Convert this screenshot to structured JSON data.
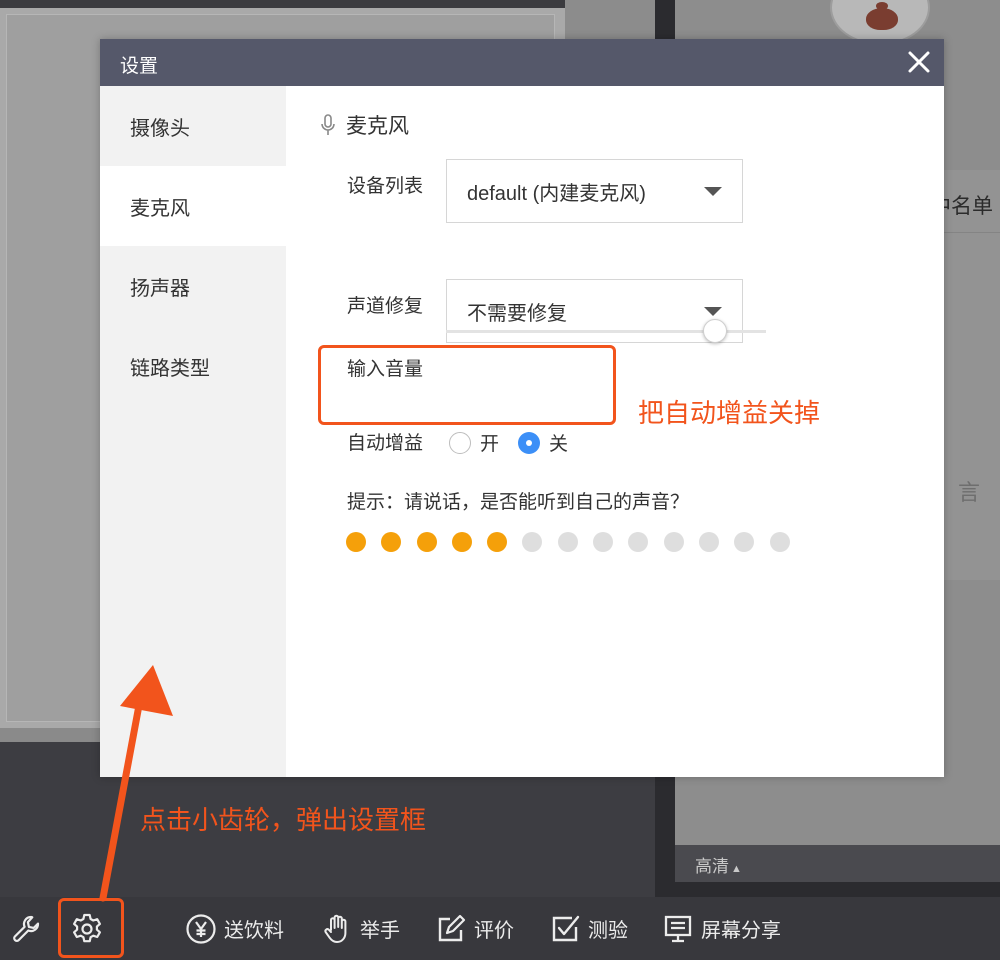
{
  "background": {
    "list_tab_label": "中名单",
    "speak_text": "言",
    "quality_label": "高清"
  },
  "toolbar": {
    "drink_label": "送饮料",
    "hand_label": "举手",
    "review_label": "评价",
    "quiz_label": "测验",
    "share_label": "屏幕分享",
    "icons": [
      "wrench-icon",
      "gear-icon",
      "yen-coin-icon",
      "hand-icon",
      "edit-icon",
      "checkbox-icon",
      "screen-share-icon"
    ]
  },
  "dialog": {
    "title": "设置",
    "sidebar": [
      {
        "label": "摄像头",
        "active": false
      },
      {
        "label": "麦克风",
        "active": true
      },
      {
        "label": "扬声器",
        "active": false
      },
      {
        "label": "链路类型",
        "active": false
      }
    ],
    "section_title": "麦克风",
    "device_list": {
      "label": "设备列表",
      "value": "default (内建麦克风)"
    },
    "channel_repair": {
      "label": "声道修复",
      "value": "不需要修复"
    },
    "input_volume": {
      "label": "输入音量",
      "level": 0.84
    },
    "auto_gain": {
      "label": "自动增益",
      "on_label": "开",
      "off_label": "关",
      "selected": "off"
    },
    "hint": "提示：请说话，是否能听到自己的声音？",
    "mic_level": {
      "total": 13,
      "lit": 5
    }
  },
  "annotations": {
    "gain_note": "把自动增益关掉",
    "gear_note": "点击小齿轮，弹出设置框"
  },
  "colors": {
    "annotation": "#f2541c",
    "radio_selected": "#3c8ff7",
    "level_on": "#f5a00a",
    "level_off": "#dedede",
    "dialog_header": "#55586a"
  }
}
